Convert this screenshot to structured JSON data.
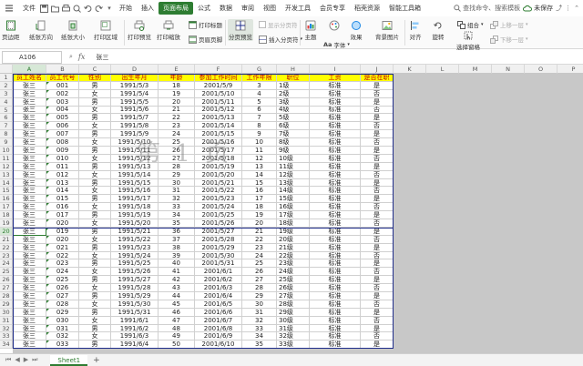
{
  "menubar": {
    "file": "文件",
    "tabs": [
      "开始",
      "插入",
      "页面布局",
      "公式",
      "数据",
      "审阅",
      "视图",
      "开发工具",
      "会员专享",
      "稻壳资源",
      "智能工具箱"
    ],
    "active_tab_index": 2,
    "search": "查找命令、搜索模板",
    "cloud": "未保存"
  },
  "ribbon": {
    "margins": "页边距",
    "orientation": "纸张方向",
    "size": "纸张大小",
    "print_area": "打印区域",
    "print_preview": "打印预览",
    "print_scale": "打印缩放",
    "print_titles": "打印标题",
    "header_footer": "页眉页脚",
    "page_break_preview": "分页预览",
    "show_page_breaks": "显示分页符",
    "insert_page_break": "插入分页符",
    "theme": "主题",
    "font": "字体",
    "effects": "效果",
    "background": "背景图片",
    "align": "对齐",
    "rotate": "旋转",
    "group": "组合",
    "move_up": "上移一层",
    "move_down": "下移一层",
    "selection_pane": "选择窗格"
  },
  "formula_bar": {
    "name_box": "A106",
    "fx": "fx",
    "content": "张三"
  },
  "columns": [
    "A",
    "B",
    "C",
    "D",
    "E",
    "F",
    "G",
    "H",
    "I",
    "J",
    "K",
    "L",
    "M",
    "N",
    "O",
    "P",
    "Q"
  ],
  "selected_column": "A",
  "selected_row": "20",
  "header_row": [
    "员工姓名",
    "员工代号",
    "性别",
    "出生年月",
    "年龄",
    "参加工作时间",
    "工作年限",
    "职位",
    "工资",
    "是否在职"
  ],
  "rows": [
    [
      "张三",
      "001",
      "男",
      "1991/5/3",
      "18",
      "2001/5/9",
      "3",
      "1级",
      "标准",
      "是"
    ],
    [
      "张三",
      "002",
      "女",
      "1991/5/4",
      "19",
      "2001/5/10",
      "4",
      "2级",
      "标准",
      "否"
    ],
    [
      "张三",
      "003",
      "男",
      "1991/5/5",
      "20",
      "2001/5/11",
      "5",
      "3级",
      "标准",
      "是"
    ],
    [
      "张三",
      "004",
      "女",
      "1991/5/6",
      "21",
      "2001/5/12",
      "6",
      "4级",
      "标准",
      "否"
    ],
    [
      "张三",
      "005",
      "男",
      "1991/5/7",
      "22",
      "2001/5/13",
      "7",
      "5级",
      "标准",
      "是"
    ],
    [
      "张三",
      "006",
      "女",
      "1991/5/8",
      "23",
      "2001/5/14",
      "8",
      "6级",
      "标准",
      "否"
    ],
    [
      "张三",
      "007",
      "男",
      "1991/5/9",
      "24",
      "2001/5/15",
      "9",
      "7级",
      "标准",
      "是"
    ],
    [
      "张三",
      "008",
      "女",
      "1991/5/10",
      "25",
      "2001/5/16",
      "10",
      "8级",
      "标准",
      "否"
    ],
    [
      "张三",
      "009",
      "男",
      "1991/5/11",
      "26",
      "2001/5/17",
      "11",
      "9级",
      "标准",
      "是"
    ],
    [
      "张三",
      "010",
      "女",
      "1991/5/12",
      "27",
      "2001/5/18",
      "12",
      "10级",
      "标准",
      "否"
    ],
    [
      "张三",
      "011",
      "男",
      "1991/5/13",
      "28",
      "2001/5/19",
      "13",
      "11级",
      "标准",
      "是"
    ],
    [
      "张三",
      "012",
      "女",
      "1991/5/14",
      "29",
      "2001/5/20",
      "14",
      "12级",
      "标准",
      "否"
    ],
    [
      "张三",
      "013",
      "男",
      "1991/5/15",
      "30",
      "2001/5/21",
      "15",
      "13级",
      "标准",
      "是"
    ],
    [
      "张三",
      "014",
      "女",
      "1991/5/16",
      "31",
      "2001/5/22",
      "16",
      "14级",
      "标准",
      "否"
    ],
    [
      "张三",
      "015",
      "男",
      "1991/5/17",
      "32",
      "2001/5/23",
      "17",
      "15级",
      "标准",
      "是"
    ],
    [
      "张三",
      "016",
      "女",
      "1991/5/18",
      "33",
      "2001/5/24",
      "18",
      "16级",
      "标准",
      "否"
    ],
    [
      "张三",
      "017",
      "男",
      "1991/5/19",
      "34",
      "2001/5/25",
      "19",
      "17级",
      "标准",
      "是"
    ],
    [
      "张三",
      "020",
      "女",
      "1991/5/20",
      "35",
      "2001/5/26",
      "20",
      "18级",
      "标准",
      "否"
    ],
    [
      "张三",
      "019",
      "男",
      "1991/5/21",
      "36",
      "2001/5/27",
      "21",
      "19级",
      "标准",
      "是"
    ],
    [
      "张三",
      "020",
      "女",
      "1991/5/22",
      "37",
      "2001/5/28",
      "22",
      "20级",
      "标准",
      "否"
    ],
    [
      "张三",
      "021",
      "男",
      "1991/5/23",
      "38",
      "2001/5/29",
      "23",
      "21级",
      "标准",
      "是"
    ],
    [
      "张三",
      "022",
      "女",
      "1991/5/24",
      "39",
      "2001/5/30",
      "24",
      "22级",
      "标准",
      "否"
    ],
    [
      "张三",
      "023",
      "男",
      "1991/5/25",
      "40",
      "2001/5/31",
      "25",
      "23级",
      "标准",
      "是"
    ],
    [
      "张三",
      "024",
      "女",
      "1991/5/26",
      "41",
      "2001/6/1",
      "26",
      "24级",
      "标准",
      "否"
    ],
    [
      "张三",
      "025",
      "男",
      "1991/5/27",
      "42",
      "2001/6/2",
      "27",
      "25级",
      "标准",
      "是"
    ],
    [
      "张三",
      "026",
      "女",
      "1991/5/28",
      "43",
      "2001/6/3",
      "28",
      "26级",
      "标准",
      "否"
    ],
    [
      "张三",
      "027",
      "男",
      "1991/5/29",
      "44",
      "2001/6/4",
      "29",
      "27级",
      "标准",
      "是"
    ],
    [
      "张三",
      "028",
      "女",
      "1991/5/30",
      "45",
      "2001/6/5",
      "30",
      "28级",
      "标准",
      "否"
    ],
    [
      "张三",
      "029",
      "男",
      "1991/5/31",
      "46",
      "2001/6/6",
      "31",
      "29级",
      "标准",
      "是"
    ],
    [
      "张三",
      "030",
      "女",
      "1991/6/1",
      "47",
      "2001/6/7",
      "32",
      "30级",
      "标准",
      "否"
    ],
    [
      "张三",
      "031",
      "男",
      "1991/6/2",
      "48",
      "2001/6/8",
      "33",
      "31级",
      "标准",
      "是"
    ],
    [
      "张三",
      "032",
      "女",
      "1991/6/3",
      "49",
      "2001/6/9",
      "34",
      "32级",
      "标准",
      "否"
    ],
    [
      "张三",
      "033",
      "男",
      "1991/6/4",
      "50",
      "2001/6/10",
      "35",
      "33级",
      "标准",
      "是"
    ]
  ],
  "watermark": "第 1 页",
  "sheet_tab": "Sheet1",
  "colors": {
    "accent": "#2e7d32",
    "header_fill": "#ffff00",
    "header_text": "#c00000",
    "page_border": "#1f2d8a"
  }
}
